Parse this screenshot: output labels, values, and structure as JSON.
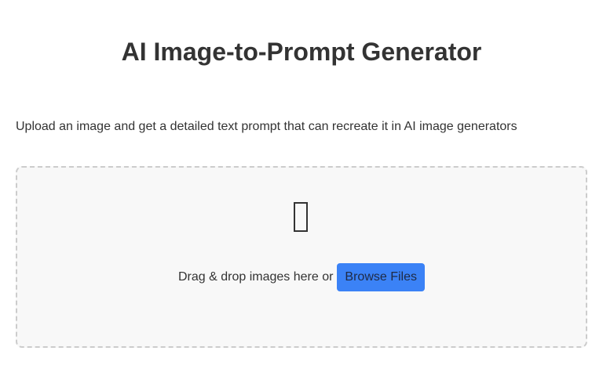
{
  "header": {
    "title": "AI Image-to-Prompt Generator"
  },
  "main": {
    "description": "Upload an image and get a detailed text prompt that can recreate it in AI image generators",
    "dropzone": {
      "icon": "image-placeholder-icon",
      "text": "Drag & drop images here or",
      "browse_label": "Browse Files"
    }
  },
  "colors": {
    "accent": "#3b82f6",
    "dropzone_background": "#f8f8f8",
    "dropzone_border": "#cccccc",
    "text": "#333333"
  }
}
